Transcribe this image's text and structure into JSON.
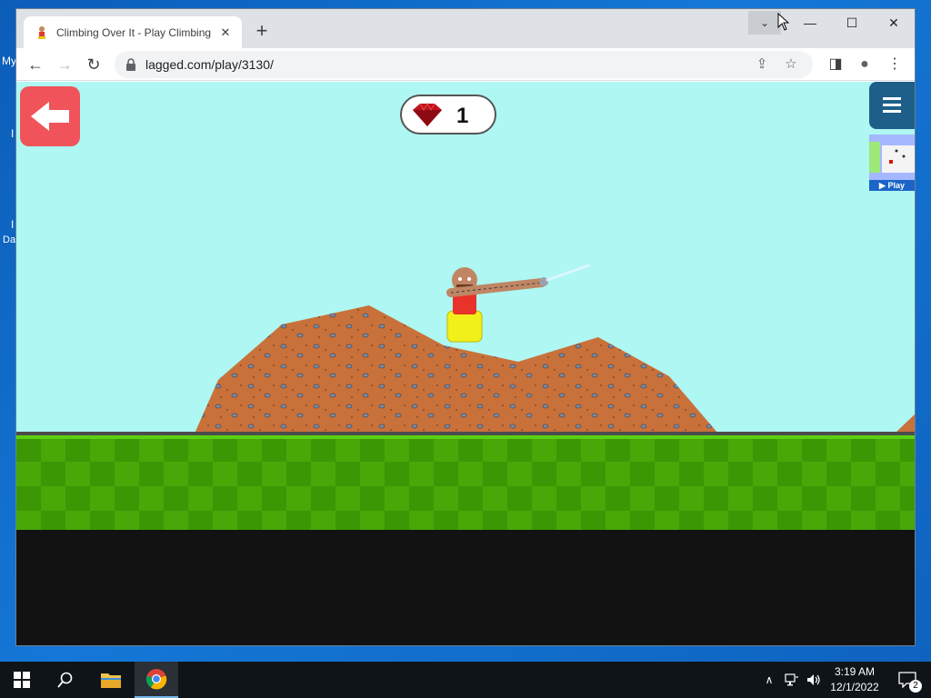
{
  "desktop": {
    "fragments": [
      "My",
      "I",
      "I",
      "Da"
    ]
  },
  "browser": {
    "tab_title": "Climbing Over It - Play Climbing",
    "tab_close": "✕",
    "new_tab": "+",
    "tab_search": "⌄",
    "controls": {
      "minimize": "—",
      "maximize": "☐",
      "close": "✕"
    },
    "url": "lagged.com/play/3130/",
    "back": "←",
    "forward": "→",
    "reload": "↻",
    "share": "⇪",
    "bookmark": "☆",
    "sidepanel": "◨",
    "profile": "●",
    "menu": "⋮"
  },
  "game": {
    "gem_count": "1",
    "mini_play_label": "▶ Play"
  },
  "taskbar": {
    "time": "3:19 AM",
    "date": "12/1/2022",
    "notification_count": "2",
    "tray_chevron": "∧",
    "volume": "🔊",
    "network": "🖧"
  },
  "colors": {
    "sky": "#aef7f2",
    "dirt": "#c9713a",
    "grass": "#47a808",
    "back_button": "#f0535a",
    "menu_button": "#1e5f8a"
  }
}
